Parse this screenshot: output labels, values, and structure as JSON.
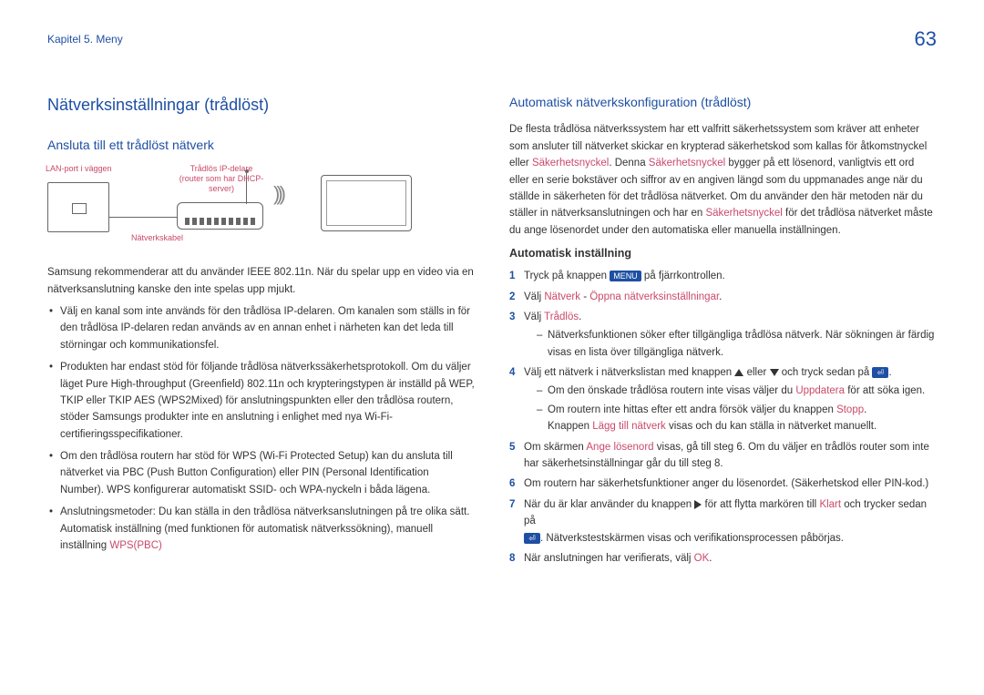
{
  "header": {
    "breadcrumb": "Kapitel 5. Meny",
    "page_number": "63"
  },
  "left": {
    "heading1": "Nätverksinställningar (trådlöst)",
    "heading2": "Ansluta till ett trådlöst nätverk",
    "diagram": {
      "lan_port": "LAN-port i väggen",
      "router_l1": "Trådlös IP-delare",
      "router_l2": "(router som har DHCP-",
      "router_l3": "server)",
      "cable": "Nätverkskabel"
    },
    "para1": "Samsung rekommenderar att du använder IEEE 802.11n. När du spelar upp en video via en nätverksanslutning kanske den inte spelas upp mjukt.",
    "b1": "Välj en kanal som inte används för den trådlösa IP-delaren. Om kanalen som ställs in för den trådlösa IP-delaren redan används av en annan enhet i närheten kan det leda till störningar och kommunikationsfel.",
    "b2": "Produkten har endast stöd för följande trådlösa nätverkssäkerhetsprotokoll. Om du väljer läget Pure High-throughput (Greenfield) 802.11n och krypteringstypen är inställd på WEP, TKIP eller TKIP AES (WPS2Mixed) för anslutningspunkten eller den trådlösa routern, stöder Samsungs produkter inte en anslutning i enlighet med nya Wi-Fi-certifieringsspecifikationer.",
    "b3": "Om den trådlösa routern har stöd för WPS (Wi-Fi Protected Setup) kan du ansluta till nätverket via PBC (Push Button Configuration) eller PIN (Personal Identification Number). WPS konfigurerar automatiskt SSID- och WPA-nyckeln i båda lägena.",
    "b4a": "Anslutningsmetoder: Du kan ställa in den trådlösa nätverksanslutningen på tre olika sätt. Automatisk inställning (med funktionen för automatisk nätverkssökning), manuell inställning ",
    "b4_kw": "WPS(PBC)"
  },
  "right": {
    "heading2": "Automatisk nätverkskonfiguration (trådlöst)",
    "para1a": "De flesta trådlösa nätverkssystem har ett valfritt säkerhetssystem som kräver att enheter som ansluter till nätverket skickar en krypterad säkerhetskod som kallas för åtkomstnyckel eller ",
    "kw_sec": "Säkerhetsnyckel",
    "para1b": ". Denna ",
    "para1c": " bygger på ett lösenord, vanligtvis ett ord eller en serie bokstäver och siffror av en angiven längd som du uppmanades ange när du ställde in säkerheten för det trådlösa nätverket. Om du använder den här metoden när du ställer in nätverksanslutningen och har en ",
    "para1d": " för det trådlösa nätverket måste du ange lösenordet under den automatiska eller manuella inställningen.",
    "heading3": "Automatisk inställning",
    "s1a": "Tryck på knappen ",
    "s1_chip": "MENU",
    "s1b": " på fjärrkontrollen.",
    "s2a": "Välj ",
    "s2_kw1": "Nätverk",
    "s2_sep": " - ",
    "s2_kw2": "Öppna nätverksinställningar",
    "s2b": ".",
    "s3a": "Välj ",
    "s3_kw": "Trådlös",
    "s3b": ".",
    "s3_dash": "Nätverksfunktionen söker efter tillgängliga trådlösa nätverk. När sökningen är färdig visas en lista över tillgängliga nätverk.",
    "s4a": "Välj ett nätverk i nätverkslistan med knappen ",
    "s4b": " eller ",
    "s4c": " och tryck sedan på ",
    "s4d": ".",
    "s4_d1a": "Om den önskade trådlösa routern inte visas väljer du ",
    "s4_d1_kw": "Uppdatera",
    "s4_d1b": " för att söka igen.",
    "s4_d2a": "Om routern inte hittas efter ett andra försök väljer du knappen ",
    "s4_d2_kw": "Stopp",
    "s4_d2b": ".",
    "s4_d2c": "Knappen ",
    "s4_d2_kw2": "Lägg till nätverk",
    "s4_d2d": " visas och du kan ställa in nätverket manuellt.",
    "s5a": "Om skärmen ",
    "s5_kw": "Ange lösenord",
    "s5b": " visas, gå till steg 6. Om du väljer en trådlös router som inte har säkerhetsinställningar går du till steg 8.",
    "s6": "Om routern har säkerhetsfunktioner anger du lösenordet. (Säkerhetskod eller PIN-kod.)",
    "s7a": "När du är klar använder du knappen ",
    "s7b": " för att flytta markören till ",
    "s7_kw": "Klart",
    "s7c": " och trycker sedan på ",
    "s7d": ". Nätverkstestskärmen visas och verifikationsprocessen påbörjas.",
    "s8a": "När anslutningen har verifierats, välj ",
    "s8_kw": "OK",
    "s8b": "."
  }
}
